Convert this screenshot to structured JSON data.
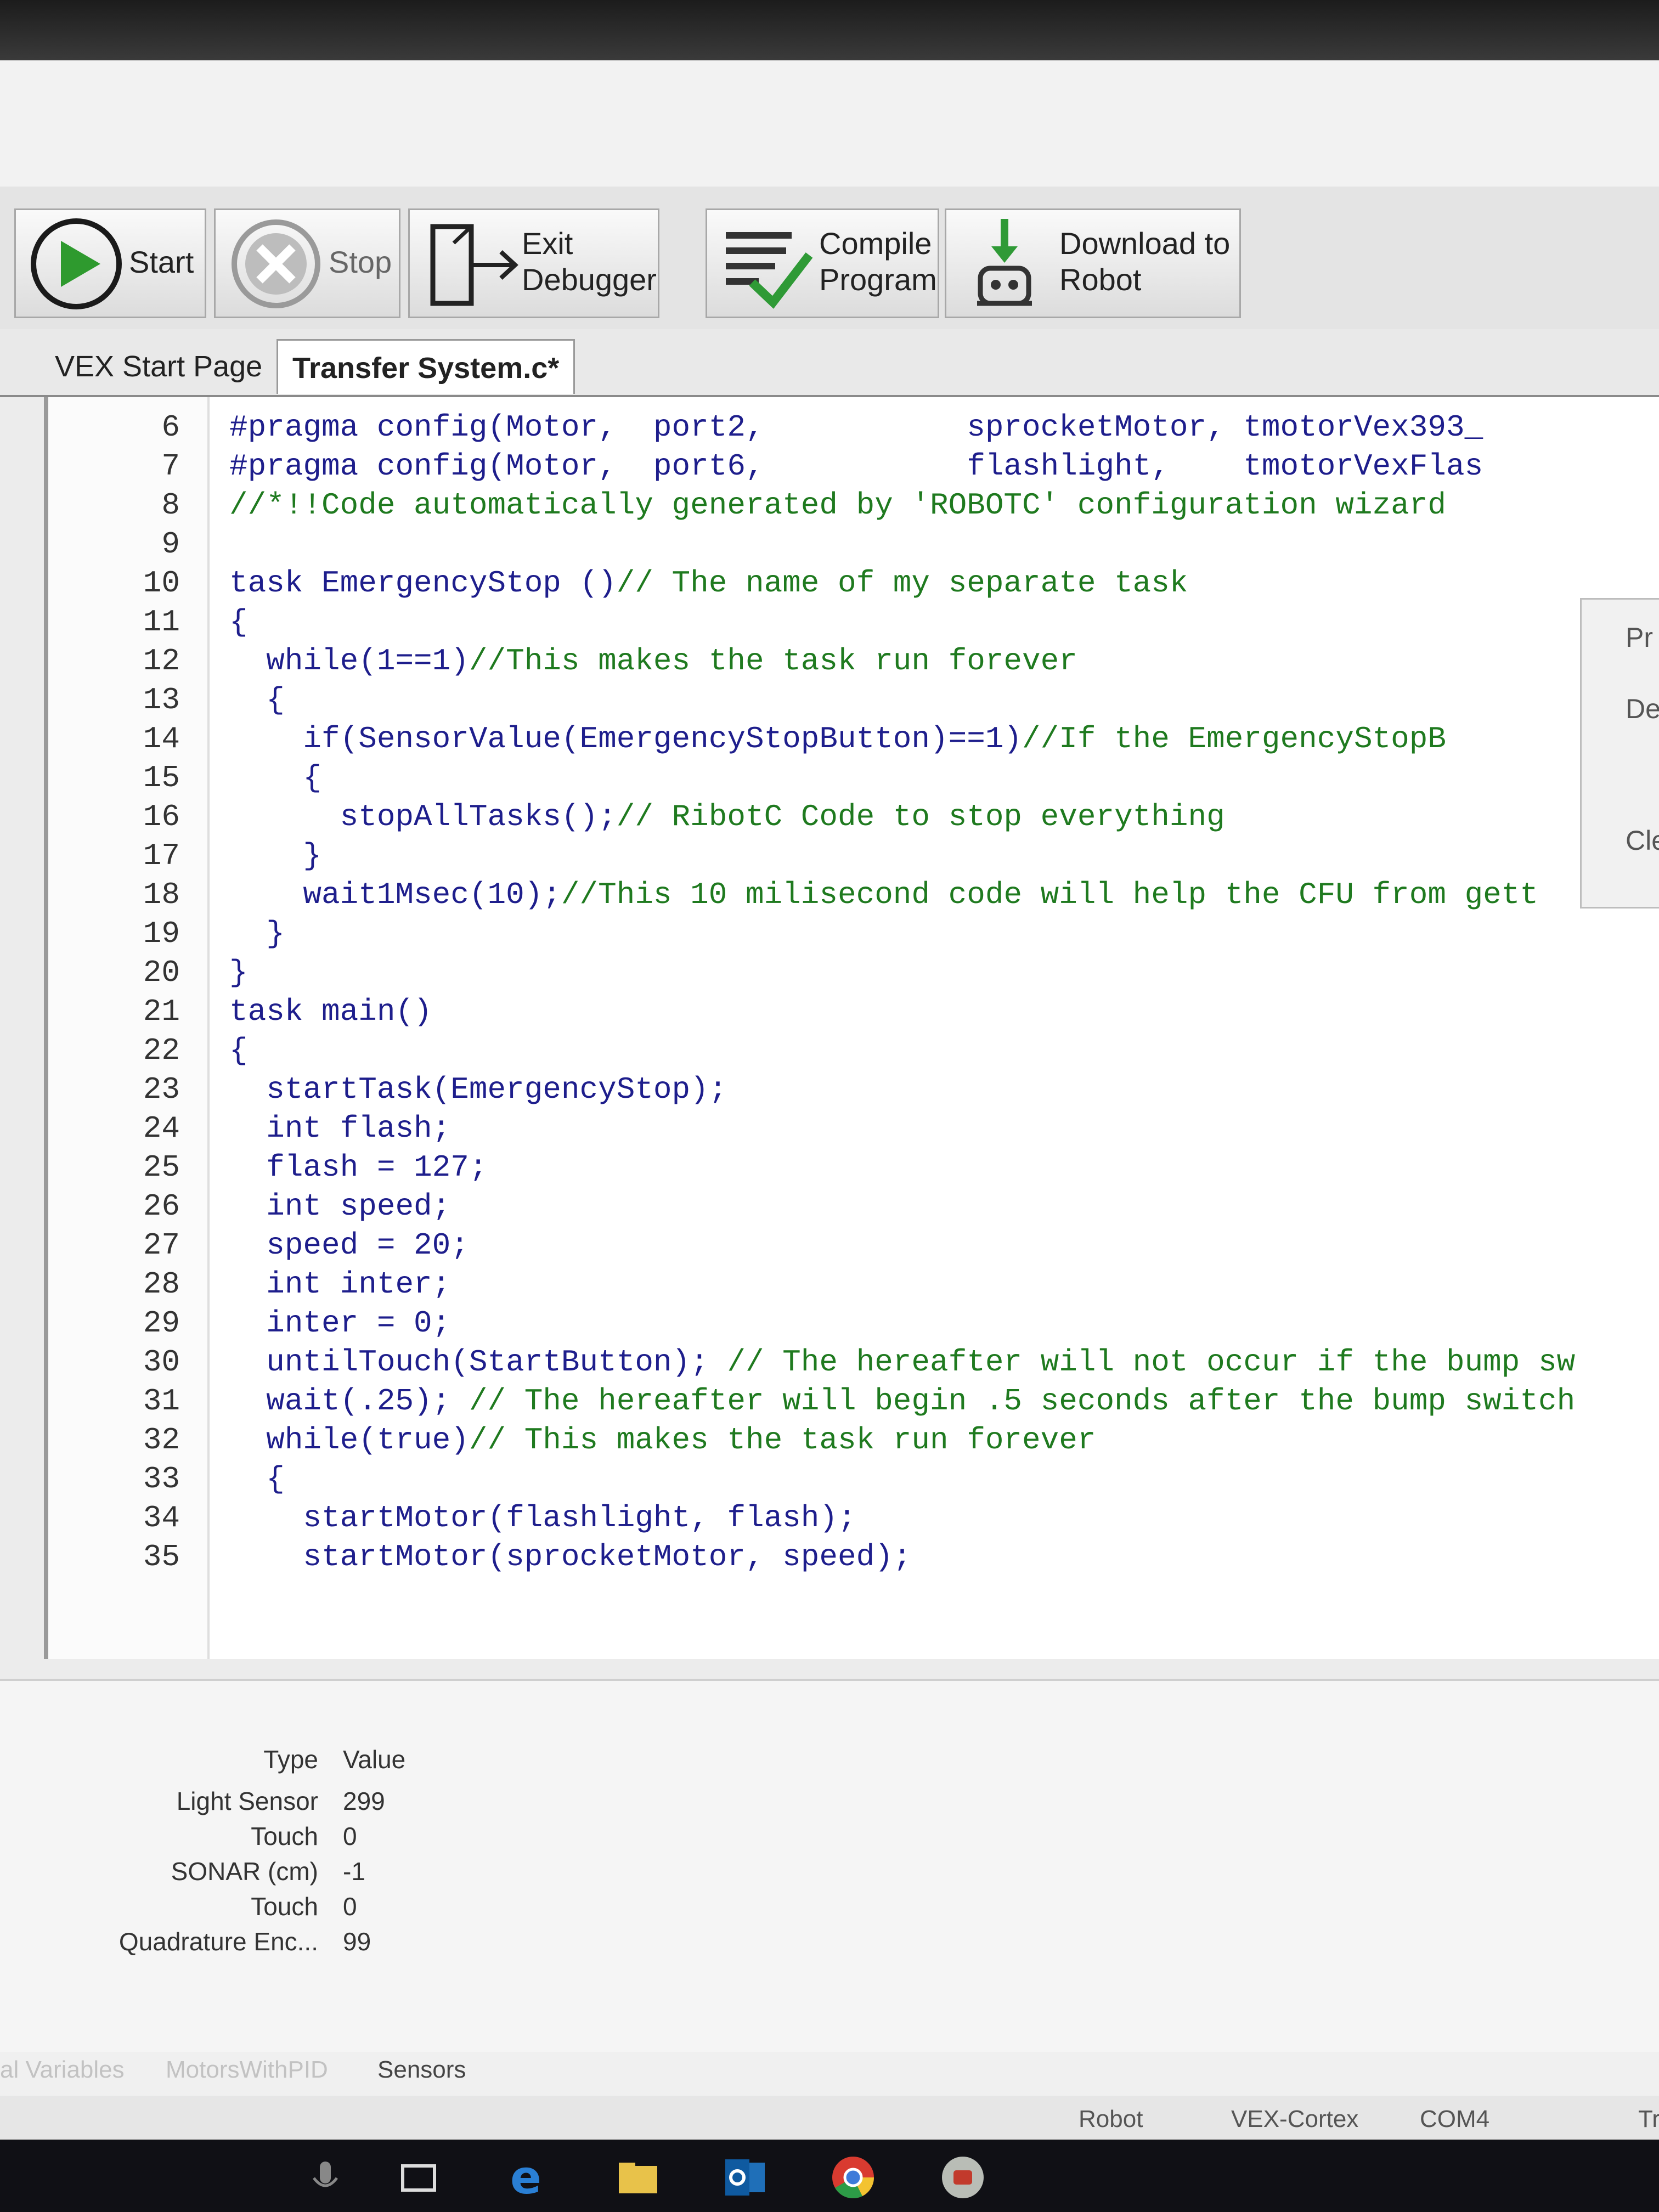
{
  "toolbar": {
    "start_label": "Start",
    "stop_label": "Stop",
    "exit_label": "Exit\nDebugger",
    "compile_label": "Compile\nProgram",
    "download_label": "Download to\nRobot"
  },
  "tabs": [
    {
      "label": "VEX Start Page"
    },
    {
      "label": "Transfer System.c*"
    }
  ],
  "code_lines": [
    {
      "n": "6",
      "t": "#pragma config(Motor,  port2,           sprocketMotor, tmotorVex393_"
    },
    {
      "n": "7",
      "t": "#pragma config(Motor,  port6,           flashlight,    tmotorVexFlas"
    },
    {
      "n": "8",
      "t": "//*!!Code automatically generated by 'ROBOTC' configuration wizard"
    },
    {
      "n": "9",
      "t": ""
    },
    {
      "n": "10",
      "t": "task EmergencyStop ()// The name of my separate task"
    },
    {
      "n": "11",
      "t": "{"
    },
    {
      "n": "12",
      "t": "  while(1==1)//This makes the task run forever"
    },
    {
      "n": "13",
      "t": "  {"
    },
    {
      "n": "14",
      "t": "    if(SensorValue(EmergencyStopButton)==1)//If the EmergencyStopB"
    },
    {
      "n": "15",
      "t": "    {"
    },
    {
      "n": "16",
      "t": "      stopAllTasks();// RibotC Code to stop everything"
    },
    {
      "n": "17",
      "t": "    }"
    },
    {
      "n": "18",
      "t": "    wait1Msec(10);//This 10 milisecond code will help the CFU from gett"
    },
    {
      "n": "19",
      "t": "  }"
    },
    {
      "n": "20",
      "t": "}"
    },
    {
      "n": "21",
      "t": "task main()"
    },
    {
      "n": "22",
      "t": "{"
    },
    {
      "n": "23",
      "t": "  startTask(EmergencyStop);"
    },
    {
      "n": "24",
      "t": "  int flash;"
    },
    {
      "n": "25",
      "t": "  flash = 127;"
    },
    {
      "n": "26",
      "t": "  int speed;"
    },
    {
      "n": "27",
      "t": "  speed = 20;"
    },
    {
      "n": "28",
      "t": "  int inter;"
    },
    {
      "n": "29",
      "t": "  inter = 0;"
    },
    {
      "n": "30",
      "t": "  untilTouch(StartButton); // The hereafter will not occur if the bump sw"
    },
    {
      "n": "31",
      "t": "  wait(.25); // The hereafter will begin .5 seconds after the bump switch"
    },
    {
      "n": "32",
      "t": "  while(true)// This makes the task run forever"
    },
    {
      "n": "33",
      "t": "  {"
    },
    {
      "n": "34",
      "t": "    startMotor(flashlight, flash);"
    },
    {
      "n": "35",
      "t": "    startMotor(sprocketMotor, speed);"
    }
  ],
  "side_panel": {
    "items": [
      "Pr",
      "De",
      "Cle"
    ]
  },
  "sensors": {
    "header_type": "Type",
    "header_value": "Value",
    "rows": [
      {
        "type": "Light Sensor",
        "value": "299"
      },
      {
        "type": "Touch",
        "value": "0"
      },
      {
        "type": "SONAR (cm)",
        "value": "-1"
      },
      {
        "type": "Touch",
        "value": "0"
      },
      {
        "type": "Quadrature Enc...",
        "value": "99"
      }
    ]
  },
  "bottom_tabs": [
    {
      "label": "al Variables"
    },
    {
      "label": "MotorsWithPID"
    },
    {
      "label": "Sensors"
    }
  ],
  "status_bar": {
    "robot": "Robot",
    "platform": "VEX-Cortex",
    "port": "COM4",
    "extra": "Tr"
  },
  "colors": {
    "start_green": "#2e9a2e",
    "keyword_blue": "#0a0ad0",
    "comment_green": "#1f7a1f",
    "download_green": "#2f9a36"
  }
}
